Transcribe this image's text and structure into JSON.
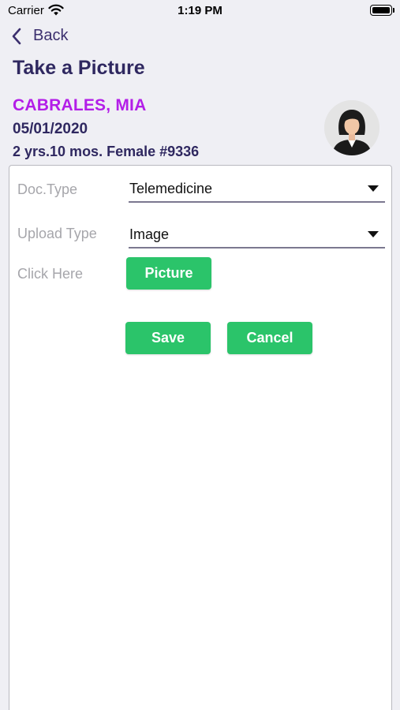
{
  "status_bar": {
    "carrier": "Carrier",
    "time": "1:19 PM"
  },
  "nav": {
    "back_label": "Back"
  },
  "page": {
    "title": "Take a Picture"
  },
  "patient": {
    "name": "CABRALES, MIA",
    "dob": "05/01/2020",
    "info": "2 yrs.10 mos. Female #9336"
  },
  "form": {
    "doc_type_label": "Doc.Type",
    "doc_type_value": "Telemedicine",
    "upload_type_label": "Upload Type",
    "upload_type_value": "Image",
    "click_here_label": "Click Here",
    "picture_button": "Picture",
    "save_button": "Save",
    "cancel_button": "Cancel"
  },
  "colors": {
    "accent_green": "#2bc46a",
    "patient_name": "#b31ee8",
    "heading": "#2f2860"
  }
}
